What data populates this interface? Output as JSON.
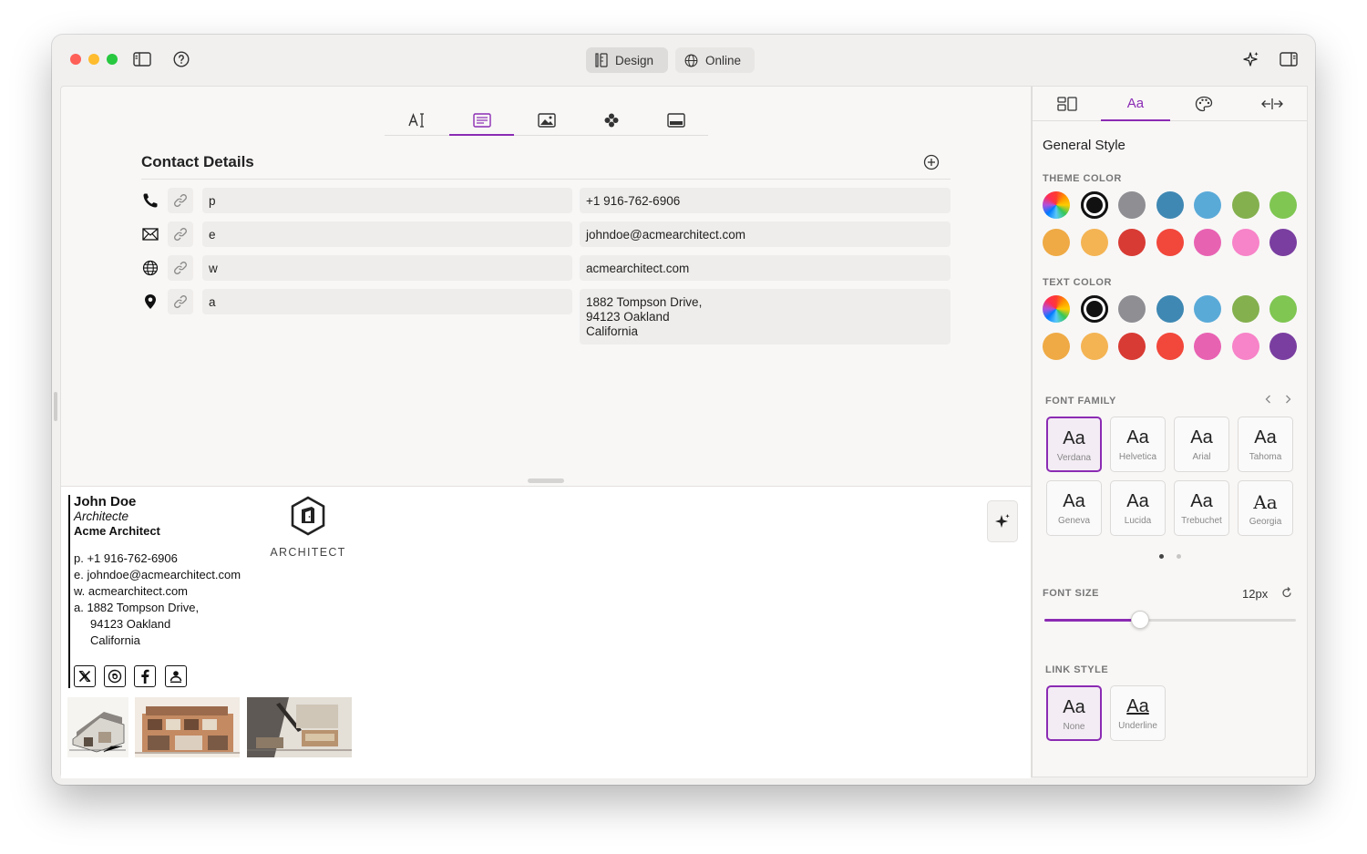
{
  "toolbar": {
    "design_label": "Design",
    "online_label": "Online"
  },
  "editor": {
    "section_title": "Contact Details",
    "rows": [
      {
        "icon": "phone-icon",
        "label": "p",
        "value": "+1 916-762-6906"
      },
      {
        "icon": "mail-icon",
        "label": "e",
        "value": "johndoe@acmearchitect.com"
      },
      {
        "icon": "globe-icon",
        "label": "w",
        "value": "acmearchitect.com"
      },
      {
        "icon": "location-pin-icon",
        "label": "a",
        "value": "1882 Tompson Drive,\n94123 Oakland\nCalifornia"
      }
    ]
  },
  "signature": {
    "name": "John Doe",
    "title": "Architecte",
    "company": "Acme Architect",
    "logo_text": "ARCHITECT",
    "lines": [
      {
        "prefix": "p.",
        "value": "+1 916-762-6906"
      },
      {
        "prefix": "e.",
        "value": "johndoe@acmearchitect.com"
      },
      {
        "prefix": "w.",
        "value": "acmearchitect.com"
      },
      {
        "prefix": "a.",
        "value": "1882 Tompson Drive,"
      }
    ],
    "address_cont": [
      "94123 Oakland",
      "California"
    ]
  },
  "sidebar": {
    "tabs": [
      "layout-icon",
      "Aa",
      "palette-icon",
      "width-icon"
    ],
    "heading": "General Style",
    "theme_color_label": "THEME COLOR",
    "text_color_label": "TEXT COLOR",
    "colors": [
      "#111111",
      "#8e8e93",
      "#3f88b3",
      "#5aaad8",
      "#84b04e",
      "#7fc652",
      "#efaa45",
      "#f4b454",
      "#d83b34",
      "#f2473b",
      "#e862b2",
      "#f783c8",
      "#7a3ea0"
    ],
    "selected_color": "#111111",
    "font_family_label": "FONT FAMILY",
    "fonts": [
      {
        "sample": "Aa",
        "name": "Verdana",
        "selected": true
      },
      {
        "sample": "Aa",
        "name": "Helvetica",
        "selected": false
      },
      {
        "sample": "Aa",
        "name": "Arial",
        "selected": false
      },
      {
        "sample": "Aa",
        "name": "Tahoma",
        "selected": false
      },
      {
        "sample": "Aa",
        "name": "Geneva",
        "selected": false
      },
      {
        "sample": "Aa",
        "name": "Lucida",
        "selected": false
      },
      {
        "sample": "Aa",
        "name": "Trebuchet",
        "selected": false
      },
      {
        "sample": "Aa",
        "name": "Georgia",
        "selected": false
      }
    ],
    "font_page": 1,
    "font_pages": 2,
    "font_size_label": "FONT SIZE",
    "font_size_value": "12px",
    "font_size_fraction": 0.38,
    "link_style_label": "LINK STYLE",
    "link_styles": [
      {
        "sample": "Aa",
        "name": "None",
        "selected": true
      },
      {
        "sample": "Aa",
        "name": "Underline",
        "selected": false
      }
    ]
  },
  "accent_color": "#8b2bb3"
}
